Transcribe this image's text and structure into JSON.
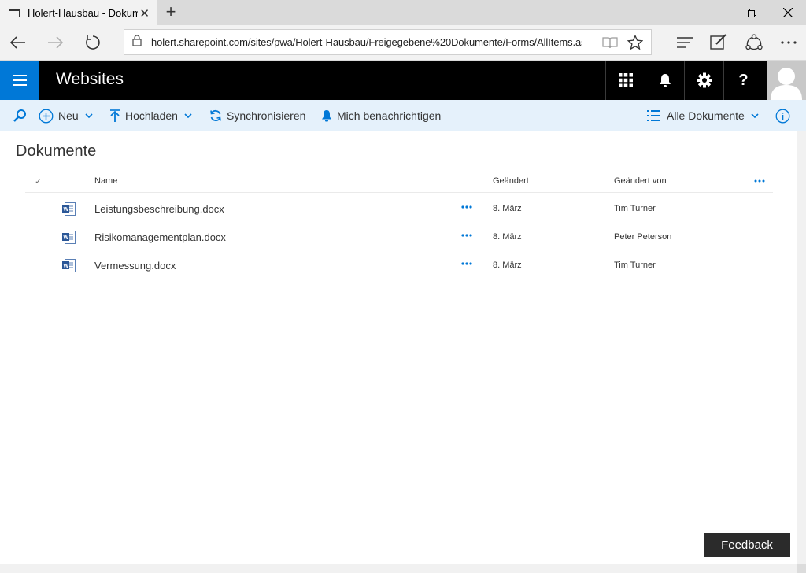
{
  "browser": {
    "tab_title": "Holert-Hausbau - Dokumente",
    "new_tab_symbol": "+",
    "url": "holert.sharepoint.com/sites/pwa/Holert-Hausbau/Freigegebene%20Dokumente/Forms/AllItems.aspx"
  },
  "suite": {
    "brand": "Websites",
    "accent_color": "#0078d7",
    "icons": [
      "app-launcher-icon",
      "bell-icon",
      "gear-icon",
      "help-icon"
    ],
    "help_symbol": "?"
  },
  "commands": {
    "new_label": "Neu",
    "upload_label": "Hochladen",
    "sync_label": "Synchronisieren",
    "notify_label": "Mich benachrichtigen",
    "view_label": "Alle Dokumente"
  },
  "library": {
    "title": "Dokumente",
    "columns": {
      "check": "✓",
      "name": "Name",
      "modified": "Geändert",
      "modified_by": "Geändert von"
    },
    "rows": [
      {
        "name": "Leistungsbeschreibung.docx",
        "modified": "8. März",
        "modified_by": "Tim Turner"
      },
      {
        "name": "Risikomanagementplan.docx",
        "modified": "8. März",
        "modified_by": "Peter Peterson"
      },
      {
        "name": "Vermessung.docx",
        "modified": "8. März",
        "modified_by": "Tim Turner"
      }
    ]
  },
  "feedback_label": "Feedback"
}
